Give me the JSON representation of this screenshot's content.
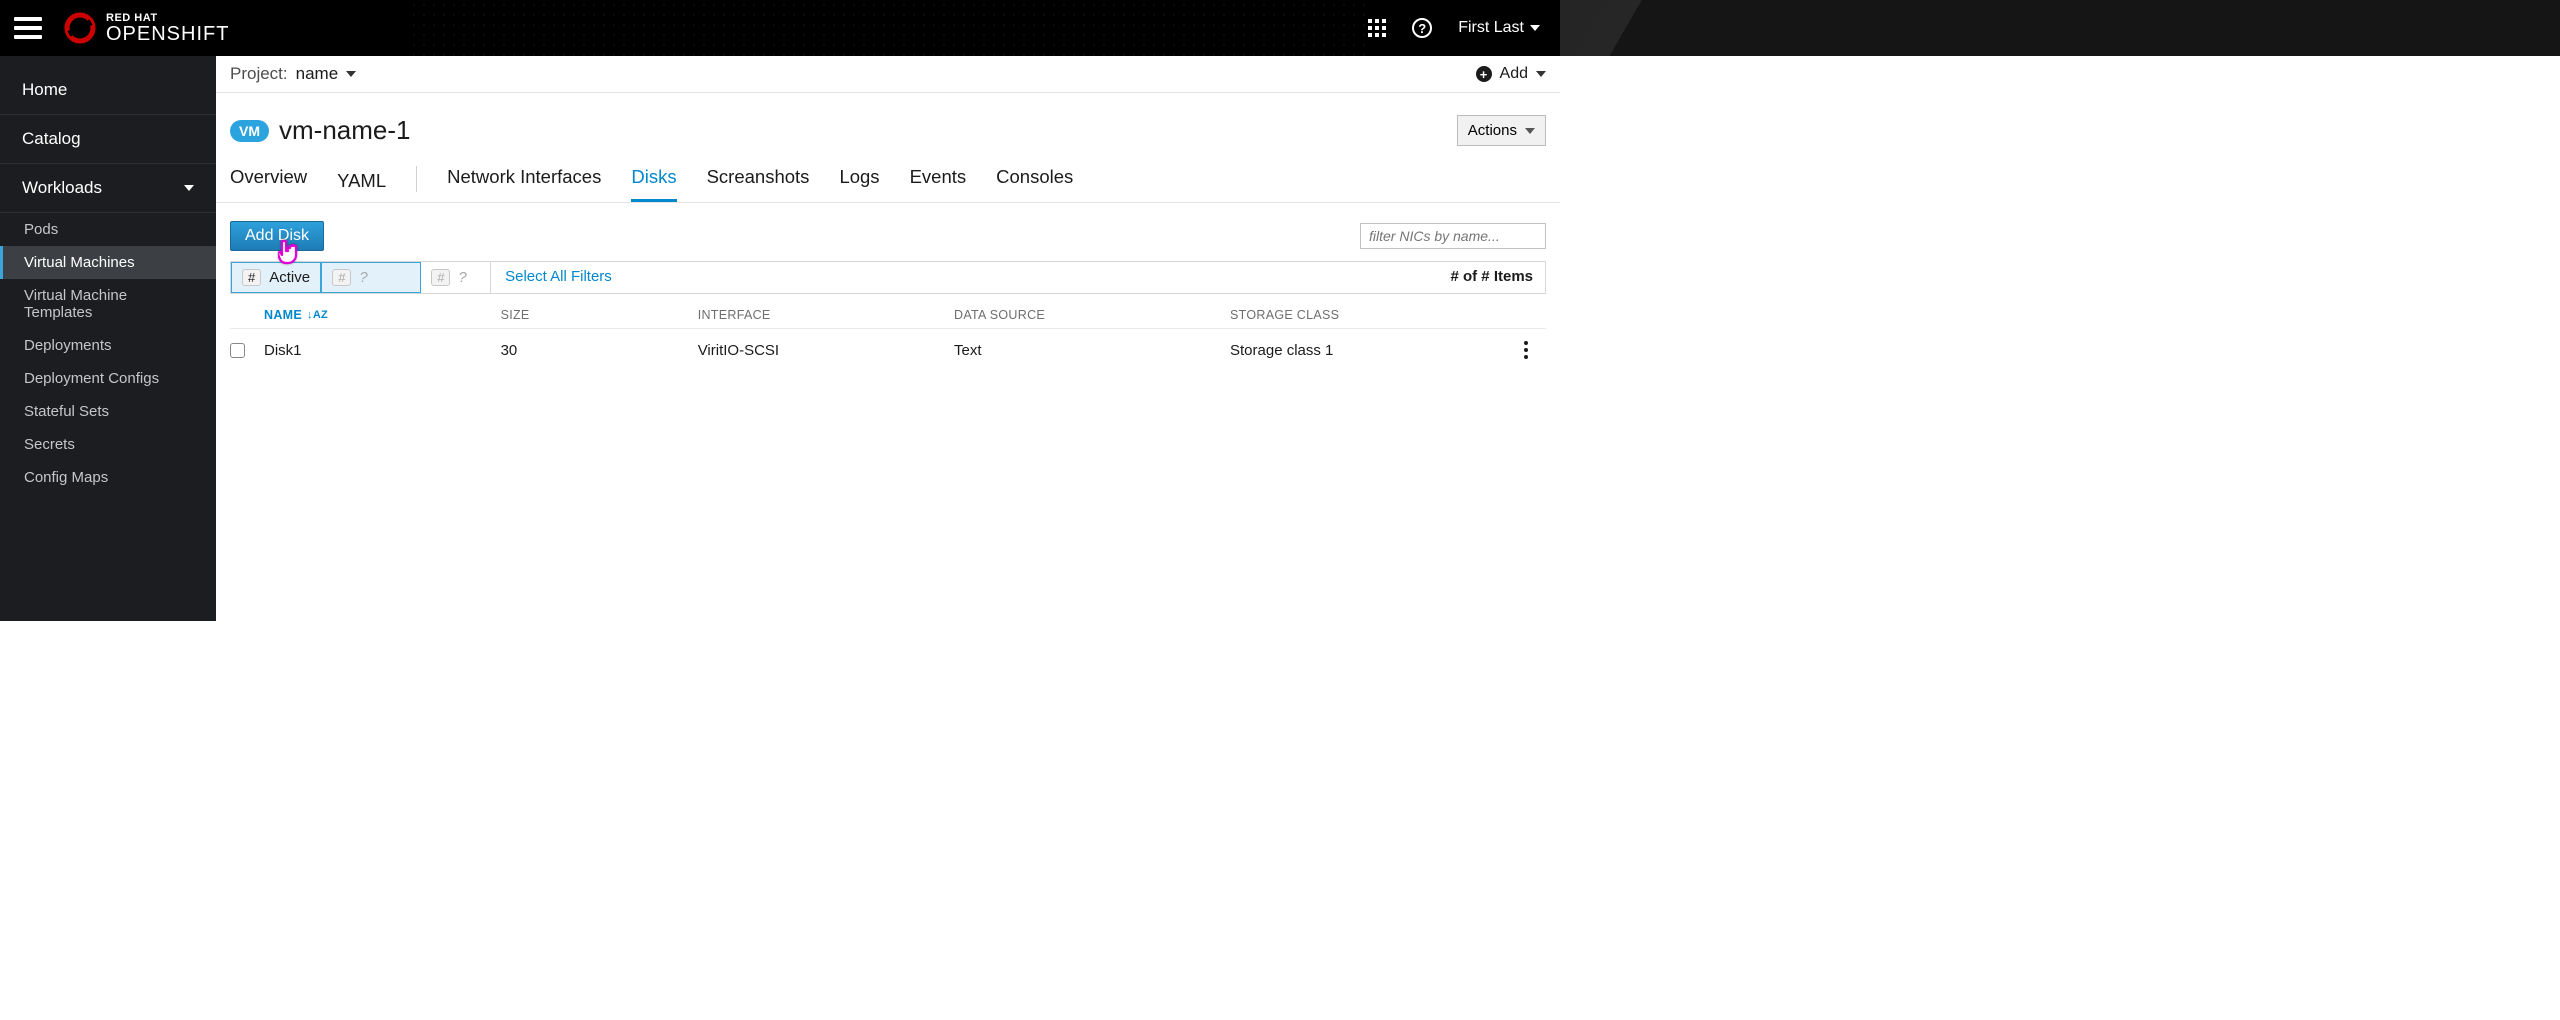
{
  "masthead": {
    "brand_line1": "RED HAT",
    "brand_line2": "OPENSHIFT",
    "help_glyph": "?",
    "user_name": "First Last"
  },
  "sidebar": {
    "sections": {
      "home": "Home",
      "catalog": "Catalog",
      "workloads": "Workloads"
    },
    "workloads_items": [
      "Pods",
      "Virtual Machines",
      "Virtual Machine Templates",
      "Deployments",
      "Deployment Configs",
      "Stateful Sets",
      "Secrets",
      "Config Maps"
    ],
    "active_index": 1
  },
  "crumb": {
    "project_label": "Project:",
    "project_value": "name",
    "add_label": "Add"
  },
  "page": {
    "vm_badge": "VM",
    "title": "vm-name-1",
    "actions_label": "Actions"
  },
  "tabs": [
    "Overview",
    "YAML",
    "Network Interfaces",
    "Disks",
    "Screanshots",
    "Logs",
    "Events",
    "Consoles"
  ],
  "active_tab": "Disks",
  "toolbar": {
    "add_disk_label": "Add Disk",
    "filter_placeholder": "filter NICs by name..."
  },
  "filter_row": {
    "active_badge": "#",
    "active_label": "Active",
    "placeholder_badge": "#",
    "placeholder_q": "?",
    "select_all": "Select All Filters",
    "count_text": "# of # Items"
  },
  "table": {
    "headers": {
      "name": "NAME",
      "size": "SIZE",
      "interface": "INTERFACE",
      "data_source": "DATA SOURCE",
      "storage": "STORAGE CLASS"
    },
    "sort_glyph": "↓A͏Z",
    "rows": [
      {
        "name": "Disk1",
        "size": "30",
        "interface": "ViritIO-SCSI",
        "data_source": "Text",
        "storage": "Storage class 1"
      }
    ]
  }
}
